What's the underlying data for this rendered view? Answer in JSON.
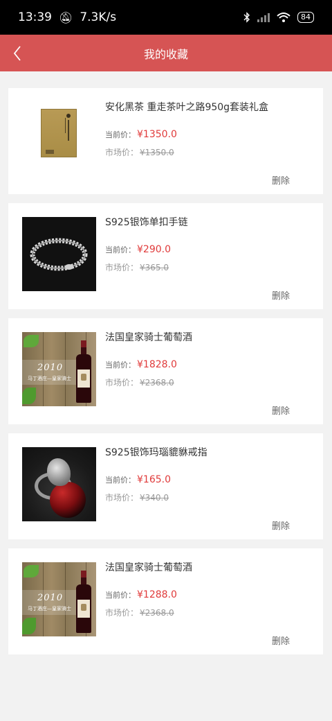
{
  "status_bar": {
    "time": "13:39",
    "net_speed": "7.3K/s",
    "battery": "84"
  },
  "nav": {
    "title": "我的收藏"
  },
  "labels": {
    "current_price": "当前价：",
    "market_price": "市场价：",
    "delete": "删除"
  },
  "items": [
    {
      "name": "安化黑茶 重走茶叶之路950g套装礼盒",
      "current_price": "¥1350.0",
      "market_price": "¥1350.0",
      "image": "tea-gift-box"
    },
    {
      "name": "S925银饰单扣手链",
      "current_price": "¥290.0",
      "market_price": "¥365.0",
      "image": "silver-bracelet"
    },
    {
      "name": "法国皇家骑士葡萄酒",
      "current_price": "¥1828.0",
      "market_price": "¥2368.0",
      "image": "red-wine"
    },
    {
      "name": "S925银饰玛瑙貔貅戒指",
      "current_price": "¥165.0",
      "market_price": "¥340.0",
      "image": "agate-ring"
    },
    {
      "name": "法国皇家骑士葡萄酒",
      "current_price": "¥1288.0",
      "market_price": "¥2368.0",
      "image": "red-wine"
    }
  ],
  "wine_image_text": {
    "year": "2010",
    "slogan": "马丁酒庄—皇家骑士"
  },
  "colors": {
    "nav_bg": "#d65454",
    "price": "#e03a3a"
  }
}
